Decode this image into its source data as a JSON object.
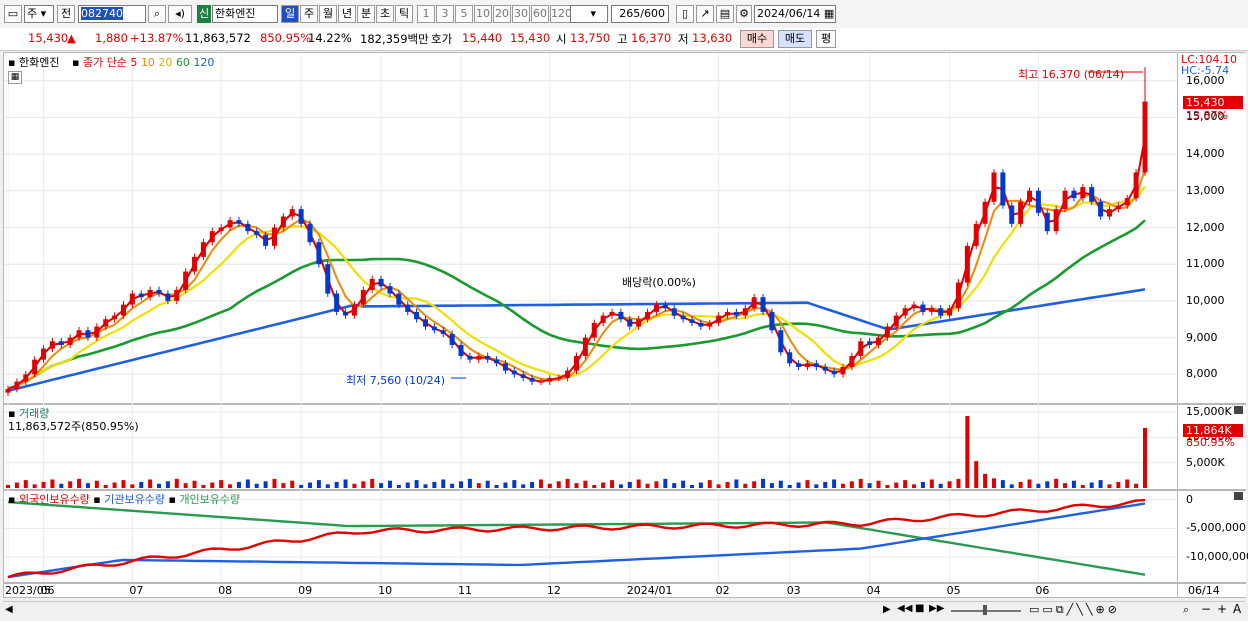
{
  "toolbar": {
    "period_select": "주",
    "prev_label": "전",
    "code": "082740",
    "badge": "신",
    "stock_name": "한화엔진",
    "periods": [
      "일",
      "주",
      "월",
      "년",
      "분",
      "초",
      "틱"
    ],
    "intervals": [
      "1",
      "3",
      "5",
      "10",
      "20",
      "30",
      "60",
      "120"
    ],
    "count": "265",
    "count_total": "/600",
    "date": "2024/06/14"
  },
  "quote": {
    "price": "15,430",
    "change": "1,880",
    "change_pct": "+13.87%",
    "volume": "11,863,572",
    "volume_ratio": "850.95%",
    "turnover": "14.22%",
    "amount": "182,359백만",
    "ask_label": "호가",
    "ask1": "15,440",
    "ask2": "15,430",
    "open_label": "시",
    "open": "13,750",
    "high_label": "고",
    "high": "16,370",
    "low_label": "저",
    "low": "13,630",
    "buy_label": "매수",
    "sell_label": "매도",
    "eval_label": "평"
  },
  "chart_data": [
    {
      "type": "candlestick",
      "title": "한화엔진",
      "legend": [
        "종가 단순 5",
        "10",
        "20",
        "60",
        "120"
      ],
      "y_ticks": [
        "16,000",
        "15,000",
        "14,000",
        "13,000",
        "12,000",
        "11,000",
        "10,000",
        "9,000",
        "8,000"
      ],
      "ylim": [
        7300,
        16700
      ],
      "x_labels": [
        "2023/05",
        "06",
        "07",
        "08",
        "09",
        "10",
        "11",
        "12",
        "2024/01",
        "02",
        "03",
        "04",
        "05",
        "06"
      ],
      "x_axis_right": "06/14",
      "close": [
        7600,
        7800,
        8000,
        8400,
        8700,
        8900,
        8800,
        9000,
        9200,
        9000,
        9300,
        9500,
        9600,
        9900,
        10200,
        10100,
        10300,
        10200,
        10000,
        10300,
        10800,
        11200,
        11600,
        11900,
        12000,
        12200,
        12100,
        11900,
        11800,
        11500,
        12000,
        12300,
        12500,
        12100,
        11600,
        11000,
        10200,
        9700,
        9600,
        9900,
        10300,
        10600,
        10400,
        10200,
        9900,
        9700,
        9500,
        9300,
        9200,
        9100,
        8800,
        8500,
        8400,
        8500,
        8400,
        8300,
        8100,
        8000,
        7900,
        7800,
        7800,
        7900,
        7900,
        8100,
        8500,
        9000,
        9400,
        9600,
        9700,
        9500,
        9300,
        9500,
        9700,
        9900,
        9800,
        9600,
        9500,
        9400,
        9300,
        9400,
        9600,
        9700,
        9600,
        9800,
        10100,
        9700,
        9200,
        8600,
        8300,
        8200,
        8300,
        8200,
        8100,
        8000,
        8200,
        8500,
        8900,
        8800,
        9000,
        9300,
        9600,
        9800,
        9900,
        9700,
        9800,
        9600,
        9800,
        10500,
        11500,
        12100,
        12700,
        13500,
        12600,
        12100,
        12700,
        13000,
        12400,
        11900,
        12500,
        13000,
        12800,
        13100,
        12700,
        12300,
        12500,
        12600,
        12800,
        13500,
        15430
      ],
      "annotations": {
        "high": "최고 16,370 (06/14)",
        "low": "최저 7,560 (10/24)",
        "dividend": "배당락(0.00%)",
        "lc": "LC:104.10",
        "hc": "HC:-5.74",
        "last": "15,430",
        "last_pct": "13.87%"
      }
    },
    {
      "type": "bar",
      "title": "거래량",
      "value_label": "11,863,572주(850.95%)",
      "y_ticks": [
        "15,000K",
        "10,000K",
        "5,000K"
      ],
      "ylim": [
        0,
        15000000
      ],
      "last": "11,864K",
      "last_pct": "850.95%"
    },
    {
      "type": "line",
      "legend": [
        "외국인보유수량",
        "기관보유수량",
        "개인보유수량"
      ],
      "y_ticks": [
        "0",
        "-5,000,000",
        "-10,000,000"
      ],
      "ylim": [
        -14000000,
        1000000
      ]
    }
  ],
  "colors": {
    "up": "#e00000",
    "down": "#0038d0",
    "ma5": "#e00000",
    "ma10": "#f08a00",
    "ma20": "#f0e000",
    "ma60": "#1a9a30",
    "ma120": "#2060e0",
    "foreign": "#e00000",
    "institution": "#2060e0",
    "individual": "#2a9a50"
  },
  "bottom": {
    "scroll_right": "▶",
    "nav": [
      "◀◀",
      "■",
      "▶▶"
    ],
    "tools": [
      "−",
      "+",
      "A"
    ]
  }
}
